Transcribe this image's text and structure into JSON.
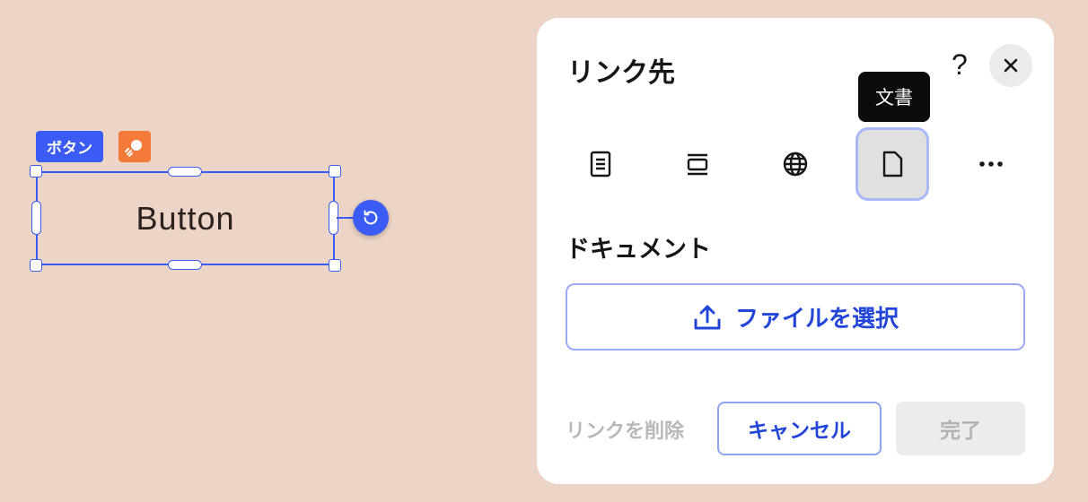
{
  "canvas": {
    "element_tag": "ボタン",
    "button_text": "Button"
  },
  "panel": {
    "title": "リンク先",
    "help_label": "?",
    "tooltip": "文書",
    "tabs": [
      {
        "icon": "page-icon",
        "selected": false
      },
      {
        "icon": "section-icon",
        "selected": false
      },
      {
        "icon": "globe-icon",
        "selected": false
      },
      {
        "icon": "document-icon",
        "selected": true
      },
      {
        "icon": "more-icon",
        "selected": false
      }
    ],
    "section_title": "ドキュメント",
    "choose_file_label": "ファイルを選択",
    "remove_link_label": "リンクを削除",
    "cancel_label": "キャンセル",
    "done_label": "完了"
  },
  "colors": {
    "background": "#ecd4c6",
    "accent": "#3b5bf5",
    "link_blue": "#2446d8",
    "ai_badge": "#f47a3a"
  }
}
